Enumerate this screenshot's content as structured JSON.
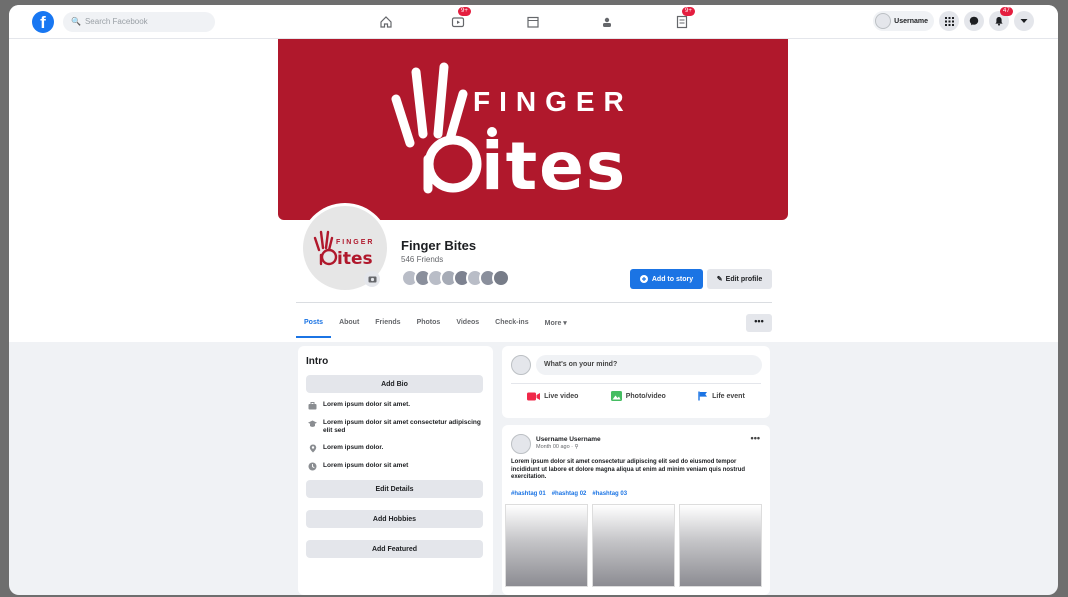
{
  "topbar": {
    "logo": "f",
    "search_placeholder": "Search Facebook",
    "nav_icons": [
      {
        "icon": "home-icon",
        "badge": ""
      },
      {
        "icon": "watch-icon",
        "badge": "9+"
      },
      {
        "icon": "marketplace-icon",
        "badge": ""
      },
      {
        "icon": "groups-icon",
        "badge": ""
      },
      {
        "icon": "gaming-icon",
        "badge": "9+"
      }
    ],
    "username": "Username",
    "notifications_badge": "47"
  },
  "cover": {
    "logo_word_top": "FINGER",
    "logo_word_bottom": "ites",
    "background_color": "#b0182c"
  },
  "profile": {
    "name": "Finger Bites",
    "friends": "546 Friends",
    "add_story": "Add to story",
    "edit_profile": "Edit profile"
  },
  "tabs": [
    "Posts",
    "About",
    "Friends",
    "Photos",
    "Videos",
    "Check-ins",
    "More ▾"
  ],
  "more_button": "•••",
  "intro": {
    "title": "Intro",
    "add_bio": "Add Bio",
    "details": [
      {
        "icon": "briefcase-icon",
        "text": "Lorem ipsum dolor sit amet."
      },
      {
        "icon": "graduation-icon",
        "text": "Lorem ipsum dolor sit amet consectetur adipiscing elit sed"
      },
      {
        "icon": "location-icon",
        "text": "Lorem ipsum dolor."
      },
      {
        "icon": "clock-icon",
        "text": "Lorem ipsum dolor sit amet"
      }
    ],
    "edit_details": "Edit Details",
    "add_hobbies": "Add Hobbies",
    "add_featured": "Add Featured"
  },
  "composer": {
    "placeholder": "What's on your mind?",
    "live_video": "Live video",
    "photo_video": "Photo/video",
    "life_event": "Life event"
  },
  "post": {
    "author": "Username Username",
    "meta": "Month 00 ago · ⚲",
    "body": "Lorem ipsum dolor sit amet consectetur adipiscing elit sed do eiusmod tempor incididunt ut labore et dolore magna aliqua ut enim ad minim veniam quis nostrud exercitation.",
    "tags": [
      "#hashtag 01",
      "#hashtag 02",
      "#hashtag 03"
    ]
  }
}
